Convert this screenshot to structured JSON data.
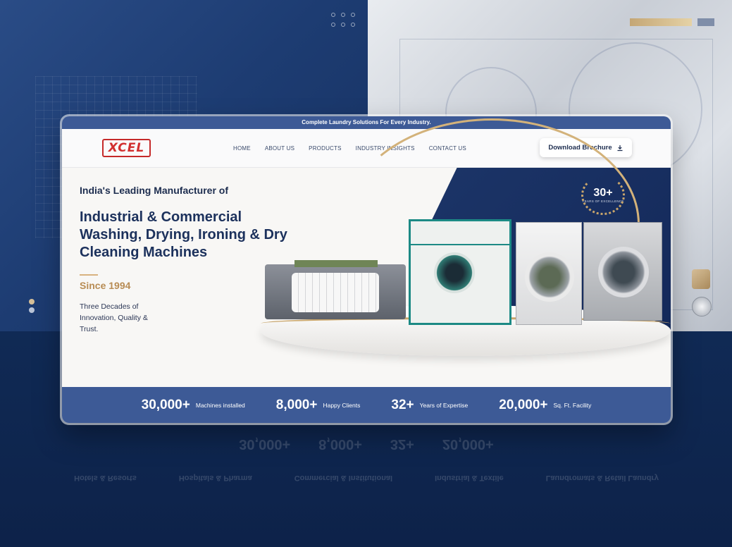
{
  "topbar": {
    "text": "Complete Laundry Solutions For Every Industry."
  },
  "logo": {
    "text": "XCEL"
  },
  "nav": {
    "items": [
      "HOME",
      "ABOUT US",
      "PRODUCTS",
      "INDUSTRY INSIGHTS",
      "CONTACT US"
    ],
    "brochure_label": "Download Brochure",
    "brochure_icon": "download-icon"
  },
  "hero": {
    "eyebrow": "India's Leading Manufacturer of",
    "headline": "Industrial & Commercial Washing, Drying, Ironing & Dry Cleaning Machines",
    "since": "Since 1994",
    "description": "Three Decades of Innovation, Quality & Trust.",
    "badge_number": "30+",
    "badge_text": "YEARS OF EXCELLENCE"
  },
  "categories": [
    {
      "label": "Hotels & Resorts",
      "icon": "building-icon"
    },
    {
      "label": "Hospitals & Pharma",
      "icon": "medical-cross-icon"
    },
    {
      "label": "Commercial & Institutional",
      "icon": "office-icon"
    },
    {
      "label": "Industrial & Textile",
      "icon": "factory-icon"
    },
    {
      "label": "Laundromats & Retail Laundry",
      "icon": "storefront-icon"
    }
  ],
  "stats": [
    {
      "number": "30,000+",
      "label": "Machines installed"
    },
    {
      "number": "8,000+",
      "label": "Happy Clients"
    },
    {
      "number": "32+",
      "label": "Years of Expertise"
    },
    {
      "number": "20,000+",
      "label": "Sq. Ft. Facility"
    }
  ],
  "colors": {
    "primary_blue": "#3d5a96",
    "navy": "#1c315c",
    "gold": "#b88c54",
    "logo_red": "#d22f2f"
  }
}
